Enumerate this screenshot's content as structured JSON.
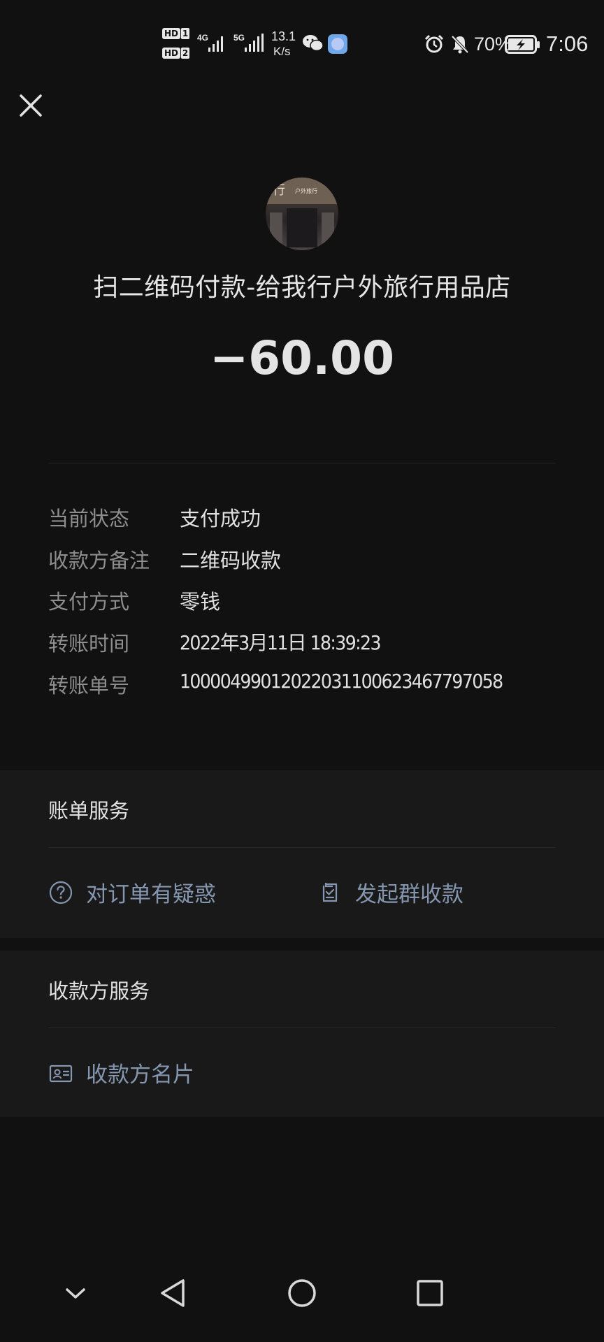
{
  "status_bar": {
    "hd1": "HD",
    "hd1_sim": "1",
    "hd2": "HD",
    "hd2_sim": "2",
    "net1": "4G",
    "net2": "5G",
    "speed_value": "13.1",
    "speed_unit": "K/s",
    "battery": "70%",
    "time": "7:06"
  },
  "header": {
    "merchant_title": "扫二维码付款-给我行户外旅行用品店",
    "amount": "−60.00",
    "avatar_sign": "行",
    "avatar_sign_small": "户外旅行"
  },
  "details": [
    {
      "label": "当前状态",
      "value": "支付成功"
    },
    {
      "label": "收款方备注",
      "value": "二维码收款"
    },
    {
      "label": "支付方式",
      "value": "零钱"
    },
    {
      "label": "转账时间",
      "value": "2022年3月11日  18:39:23"
    },
    {
      "label": "转账单号",
      "value": "100004990120220311006234677970​58"
    }
  ],
  "bill_service": {
    "title": "账单服务",
    "dispute_label": "对订单有疑惑",
    "group_collect_label": "发起群收款"
  },
  "payee_service": {
    "title": "收款方服务",
    "card_label": "收款方名片"
  },
  "colors": {
    "background": "#111111",
    "section_bg": "#191919",
    "link": "#8597b0"
  }
}
